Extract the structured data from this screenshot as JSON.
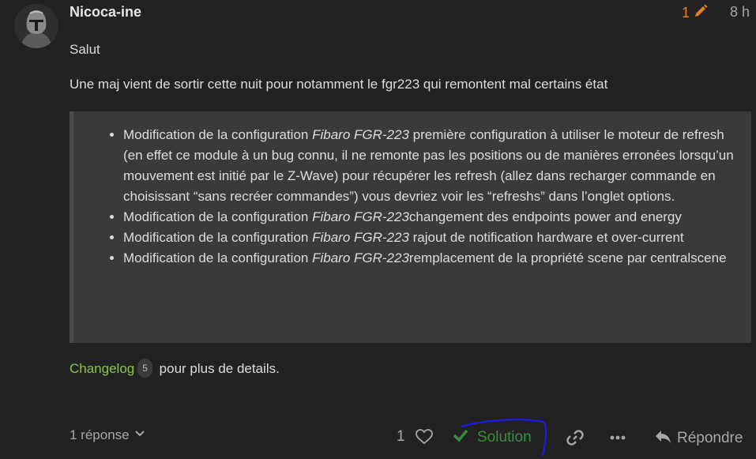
{
  "post": {
    "username": "Nicoca-ine",
    "edit_count": "1",
    "age": "8 h",
    "greeting": "Salut",
    "intro": "Une maj vient de sortir cette nuit pour notamment le fgr223 qui remontent mal certains état",
    "quote_items": [
      {
        "prefix": "Modification de la configuration ",
        "device": "Fibaro FGR-223",
        "text": " première configuration à utiliser le moteur de refresh (en effet ce module à un bug connu, il ne remonte pas les positions ou de manières erronées lorsqu’un mouvement est initié par le Z-Wave) pour récupérer les refresh (allez dans recharger commande en choisissant “sans recréer commandes”) vous devriez voir les “refreshs” dans l’onglet options."
      },
      {
        "prefix": "Modification de la configuration ",
        "device": "Fibaro FGR-223",
        "text": "changement des endpoints power and energy"
      },
      {
        "prefix": "Modification de la configuration ",
        "device": "Fibaro FGR-223",
        "text": " rajout de notification hardware et over-current"
      },
      {
        "prefix": "Modification de la configuration ",
        "device": "Fibaro FGR-223",
        "text": "remplacement de la propriété scene par centralscene"
      }
    ],
    "changelog_link": "Changelog",
    "changelog_count": "5",
    "changelog_suffix": " pour plus de details."
  },
  "footer": {
    "replies_label": "1 réponse",
    "like_count": "1",
    "solution_label": "Solution",
    "reply_label": "Répondre"
  },
  "colors": {
    "background": "#222222",
    "accent_edit": "#e67e22",
    "link": "#8bc34a",
    "solution": "#388e3c",
    "annotation": "#1a1aff"
  },
  "icons": {
    "edit": "pencil-icon",
    "like": "heart-icon",
    "solution": "check-icon",
    "link": "link-icon",
    "more": "ellipsis-icon",
    "reply": "reply-icon",
    "replies": "chevron-down-icon"
  }
}
